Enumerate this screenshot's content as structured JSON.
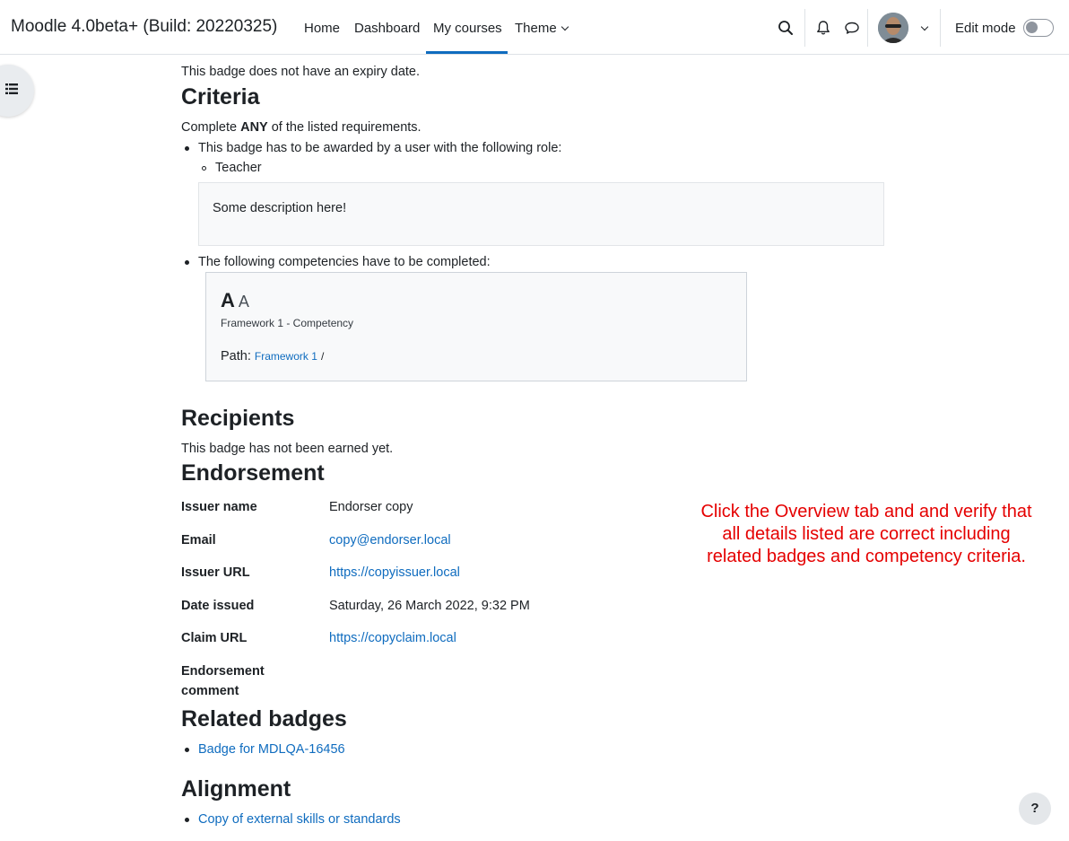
{
  "navbar": {
    "brand": "Moodle 4.0beta+ (Build: 20220325)",
    "items": [
      {
        "label": "Home"
      },
      {
        "label": "Dashboard"
      },
      {
        "label": "My courses"
      },
      {
        "label": "Theme"
      }
    ],
    "edit_mode_label": "Edit mode"
  },
  "content": {
    "expiry_text": "This badge does not have an expiry date.",
    "criteria": {
      "heading": "Criteria",
      "intro_prefix": "Complete ",
      "intro_bold": "ANY",
      "intro_suffix": " of the listed requirements.",
      "role_requirement": "This badge has to be awarded by a user with the following role:",
      "role": "Teacher",
      "description": "Some description here!",
      "competency_requirement": "The following competencies have to be completed:",
      "competency": {
        "shortname": "A",
        "idnumber": "A",
        "framework": "Framework 1 - Competency",
        "path_label": "Path:",
        "path_link": "Framework 1",
        "path_sep": "/"
      }
    },
    "recipients": {
      "heading": "Recipients",
      "text": "This badge has not been earned yet."
    },
    "endorsement": {
      "heading": "Endorsement",
      "rows": [
        {
          "label": "Issuer name",
          "value": "Endorser copy"
        },
        {
          "label": "Email",
          "value": "copy@endorser.local"
        },
        {
          "label": "Issuer URL",
          "value": "https://copyissuer.local"
        },
        {
          "label": "Date issued",
          "value": "Saturday, 26 March 2022, 9:32 PM"
        },
        {
          "label": "Claim URL",
          "value": "https://copyclaim.local"
        }
      ],
      "comment_label_line1": "Endorsement",
      "comment_label_line2": "comment"
    },
    "related": {
      "heading": "Related badges",
      "items": [
        "Badge for MDLQA-16456"
      ]
    },
    "alignment": {
      "heading": "Alignment",
      "items": [
        "Copy of external skills or standards"
      ]
    }
  },
  "annotation": {
    "line1": "Click the Overview tab and and verify that",
    "line2": "all details listed are correct including",
    "line3": "related badges and competency criteria."
  },
  "help_label": "?",
  "colors": {
    "link": "#0f6cbf",
    "annotation": "#e50000",
    "active_tab": "#0f6cbf"
  }
}
